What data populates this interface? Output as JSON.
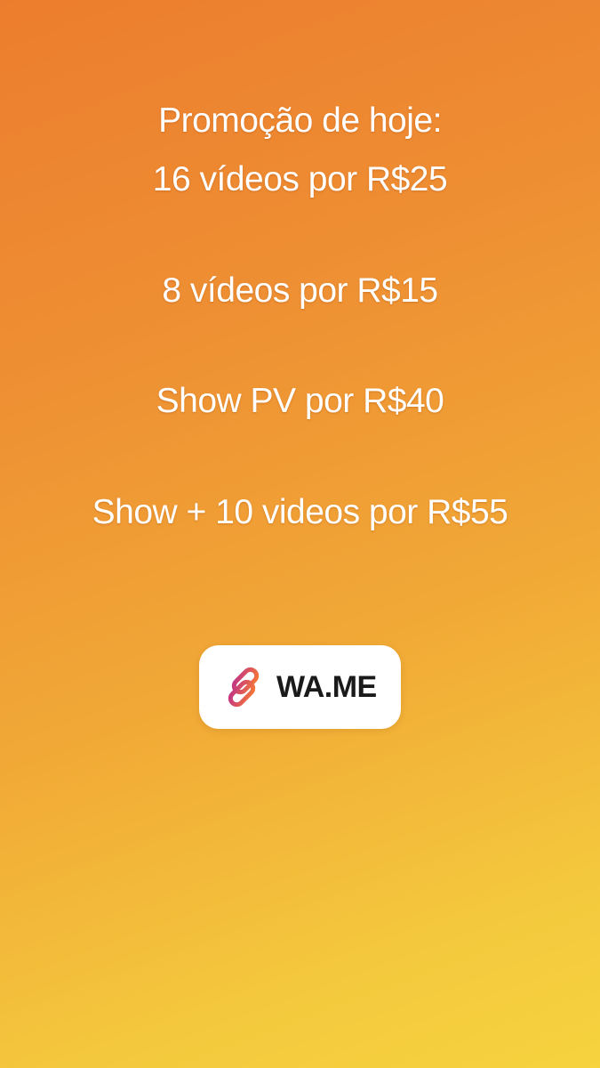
{
  "promo": {
    "line1": "Promoção de hoje:",
    "line2": "16 vídeos por R$25",
    "line3": "8 vídeos por R$15",
    "line4": "Show PV por R$40",
    "line5": "Show + 10 videos por R$55"
  },
  "link_sticker": {
    "label": "WA.ME",
    "icon": "link-icon"
  },
  "colors": {
    "background_top": "#ec7d2e",
    "background_bottom": "#f6d33f",
    "text": "#ffffff",
    "sticker_bg": "#ffffff",
    "icon_gradient_start": "#f77737",
    "icon_gradient_end": "#c13584"
  }
}
